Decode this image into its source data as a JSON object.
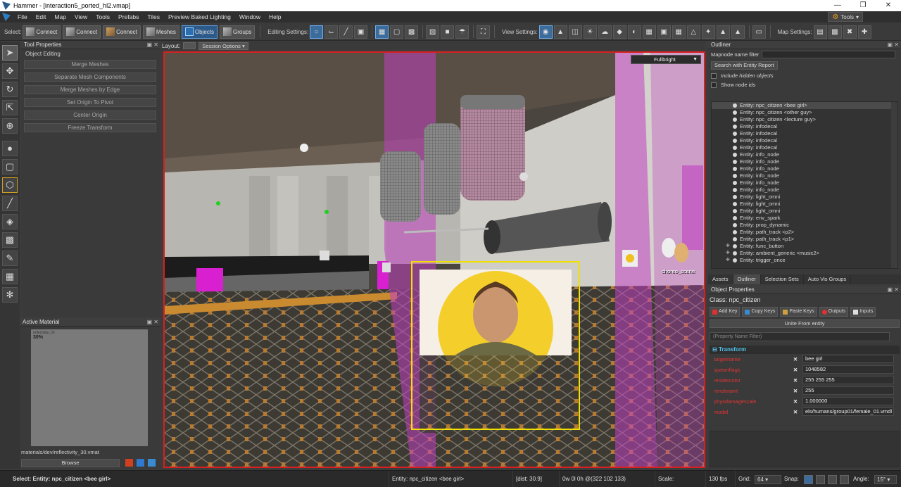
{
  "window": {
    "title": "Hammer - [interaction5_ported_hl2.vmap]",
    "min_glyph": "—",
    "max_glyph": "❐",
    "close_glyph": "✕"
  },
  "menu": {
    "items": [
      "File",
      "Edit",
      "Map",
      "View",
      "Tools",
      "Prefabs",
      "Tiles",
      "Preview Baked Lighting",
      "Window",
      "Help"
    ],
    "tools_button": "Tools"
  },
  "toolbar": {
    "select_label": "Select:",
    "buttons": [
      "Connect",
      "Connect",
      "Connect",
      "Meshes",
      "Objects",
      "Groups"
    ],
    "editing_label": "Editing Settings:",
    "view_label": "View Settings:",
    "map_label": "Map Settings:"
  },
  "tool_properties": {
    "title": "Tool Properties",
    "section": "Object Editing",
    "buttons": [
      "Merge Meshes",
      "Separate Mesh Components",
      "Merge Meshes by Edge",
      "Set Origin To Pivot",
      "Center Origin",
      "Freeze Transform"
    ]
  },
  "active_material": {
    "title": "Active Material",
    "preview_name": "reflectivity_30",
    "preview_percent": "30%",
    "path": "materials/dev/reflectivity_30.vmat",
    "browse_label": "Browse"
  },
  "layout": {
    "label": "Layout:",
    "session_options": "Session Options"
  },
  "viewport": {
    "render_mode": "Fullbright",
    "choreo_label": "choreo_scene"
  },
  "outliner": {
    "title": "Outliner",
    "mapnode_filter_label": "Mapnode name filter",
    "search_button": "Search with Entity Report",
    "include_hidden": "Include hidden objects",
    "show_node_ids": "Show node ids",
    "entities": [
      "Entity: npc_citizen <bee girl>",
      "Entity: npc_citizen <other guy>",
      "Entity: npc_citizen <lecture guy>",
      "Entity: infodecal",
      "Entity: infodecal",
      "Entity: infodecal",
      "Entity: infodecal",
      "Entity: info_node",
      "Entity: info_node",
      "Entity: info_node",
      "Entity: info_node",
      "Entity: info_node",
      "Entity: info_node",
      "Entity: light_omni",
      "Entity: light_omni",
      "Entity: light_omni",
      "Entity: env_spark",
      "Entity: prop_dynamic",
      "Entity: path_track <p2>",
      "Entity: path_track <p1>",
      "Entity: func_button",
      "Entity: ambient_generic <music2>",
      "Entity: trigger_once"
    ]
  },
  "tabs": [
    "Assets",
    "Outliner",
    "Selection Sets",
    "Auto Vis Groups"
  ],
  "object_properties": {
    "title": "Object Properties",
    "class_label": "Class:",
    "class_value": "npc_citizen",
    "buttons": [
      "Add Key",
      "Copy Keys",
      "Paste Keys",
      "Outputs",
      "Inputs"
    ],
    "unite_button": "Unite From entity",
    "filter_placeholder": "(Property Name Filter)",
    "section": "Transform",
    "properties": [
      {
        "key": "targetname",
        "value": "bee girl"
      },
      {
        "key": "spawnflags",
        "value": "1048582"
      },
      {
        "key": "rendercolor",
        "value": "255 255 255"
      },
      {
        "key": "renderamt",
        "value": "255"
      },
      {
        "key": "physdamagescale",
        "value": "1.000000"
      },
      {
        "key": "model",
        "value": "els/humans/group01/female_01.vmdl"
      }
    ]
  },
  "status": {
    "selection": "Select: Entity: npc_citizen <bee girl>",
    "hover": "Entity: npc_citizen <bee girl>",
    "dist": "[dist: 30.9]",
    "coords": "0w 0l 0h @(322 102 133)",
    "scale_label": "Scale:",
    "fps": "130 fps",
    "grid_label": "Grid:",
    "grid_value": "64",
    "snap_label": "Snap:",
    "angle_label": "Angle:",
    "angle_value": "15°"
  },
  "colors": {
    "selection_outline": "#d82020",
    "selected_box": "#f0e000",
    "trigger_volume": "#c040c0",
    "active_toolbar": "#2e5a8a"
  }
}
